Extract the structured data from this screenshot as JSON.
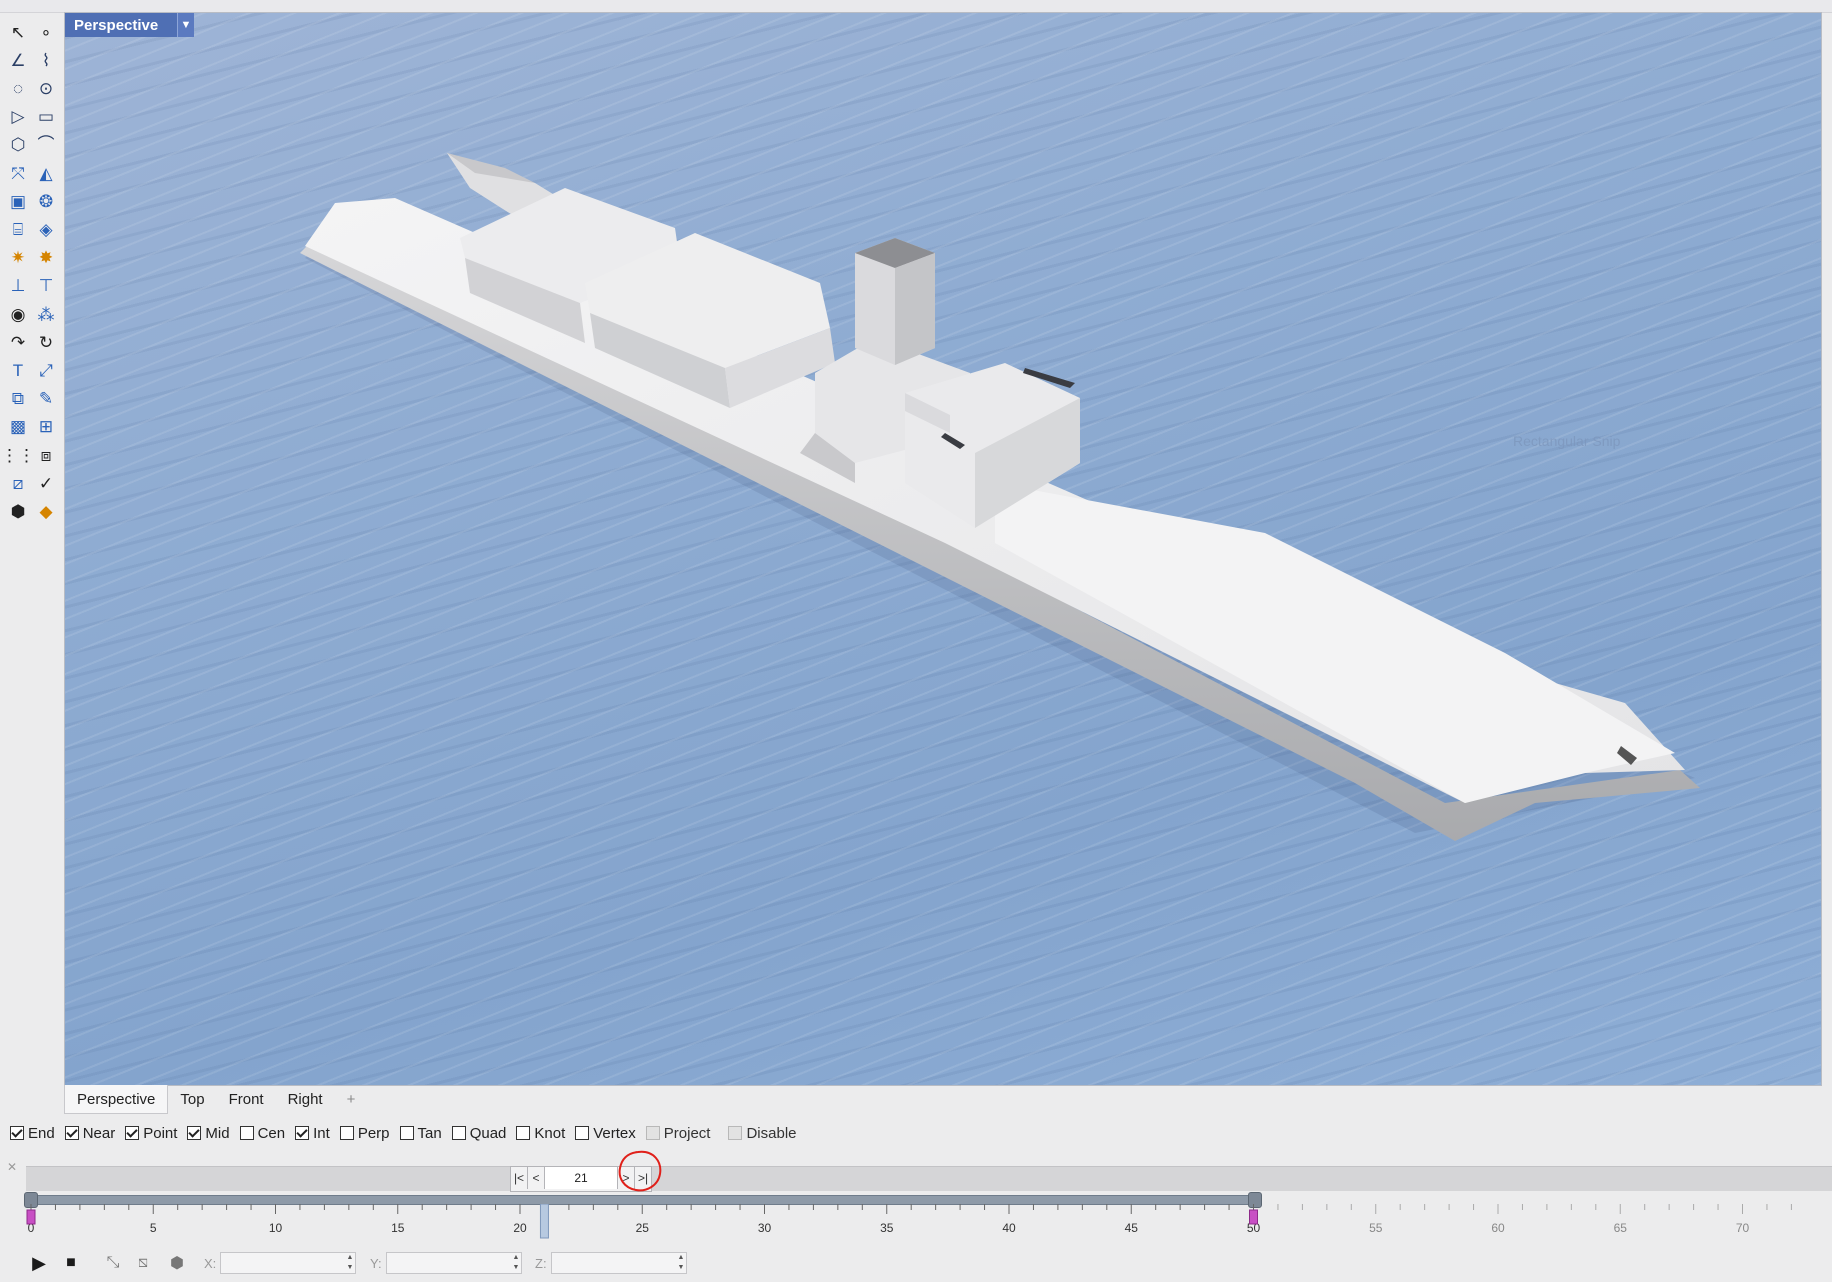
{
  "viewport": {
    "label": "Perspective",
    "dropdown_icon": "caret-down",
    "watermark": "Rectangular Snip"
  },
  "toolbar": {
    "tools": [
      {
        "name": "select-arrow-icon",
        "glyph": "↖",
        "tone": "dark"
      },
      {
        "name": "point-icon",
        "glyph": "∘",
        "tone": "dark"
      },
      {
        "name": "polyline-icon",
        "glyph": "∠",
        "tone": ""
      },
      {
        "name": "curve-points-icon",
        "glyph": "⌇",
        "tone": ""
      },
      {
        "name": "circle-icon",
        "glyph": "◌",
        "tone": ""
      },
      {
        "name": "ellipse-icon",
        "glyph": "⊙",
        "tone": ""
      },
      {
        "name": "polygon-icon",
        "glyph": "▷",
        "tone": ""
      },
      {
        "name": "rectangle-icon",
        "glyph": "▭",
        "tone": ""
      },
      {
        "name": "hexagon-icon",
        "glyph": "⬡",
        "tone": ""
      },
      {
        "name": "arc-icon",
        "glyph": "⌒",
        "tone": ""
      },
      {
        "name": "transform-icon",
        "glyph": "⤧",
        "tone": "blue"
      },
      {
        "name": "surface-icon",
        "glyph": "◭",
        "tone": "blue"
      },
      {
        "name": "box-icon",
        "glyph": "▣",
        "tone": "blue"
      },
      {
        "name": "boolean-union-icon",
        "glyph": "❂",
        "tone": "blue"
      },
      {
        "name": "cylinder-icon",
        "glyph": "⌸",
        "tone": "blue"
      },
      {
        "name": "mesh-icon",
        "glyph": "◈",
        "tone": "blue"
      },
      {
        "name": "gear-icon",
        "glyph": "✷",
        "tone": "orange"
      },
      {
        "name": "explode-icon",
        "glyph": "✸",
        "tone": "orange"
      },
      {
        "name": "extrude-icon",
        "glyph": "⊥",
        "tone": "blue"
      },
      {
        "name": "plane-icon",
        "glyph": "⊤",
        "tone": "blue"
      },
      {
        "name": "solid-icon",
        "glyph": "◉",
        "tone": "dark"
      },
      {
        "name": "spheres-icon",
        "glyph": "⁂",
        "tone": "blue"
      },
      {
        "name": "fillet-icon",
        "glyph": "↷",
        "tone": "dark"
      },
      {
        "name": "blend-icon",
        "glyph": "↻",
        "tone": "dark"
      },
      {
        "name": "text-icon",
        "glyph": "T",
        "tone": "blue"
      },
      {
        "name": "scale-icon",
        "glyph": "⤢",
        "tone": "blue"
      },
      {
        "name": "group-icon",
        "glyph": "⧉",
        "tone": "blue"
      },
      {
        "name": "edit-icon",
        "glyph": "✎",
        "tone": "blue"
      },
      {
        "name": "block-icon",
        "glyph": "▩",
        "tone": "blue"
      },
      {
        "name": "dimension-icon",
        "glyph": "⊞",
        "tone": "blue"
      },
      {
        "name": "array-icon",
        "glyph": "⋮⋮",
        "tone": "dark"
      },
      {
        "name": "layers-icon",
        "glyph": "⧈",
        "tone": "dark"
      },
      {
        "name": "analyze-icon",
        "glyph": "⧄",
        "tone": "blue"
      },
      {
        "name": "check-icon",
        "glyph": "✓",
        "tone": "dark"
      },
      {
        "name": "render-icon",
        "glyph": "⬢",
        "tone": "dark"
      },
      {
        "name": "light-icon",
        "glyph": "◆",
        "tone": "orange"
      }
    ]
  },
  "tabs": [
    {
      "label": "Perspective",
      "active": true
    },
    {
      "label": "Top",
      "active": false
    },
    {
      "label": "Front",
      "active": false
    },
    {
      "label": "Right",
      "active": false
    }
  ],
  "tab_add_glyph": "+",
  "osnaps": [
    {
      "label": "End",
      "checked": true,
      "disabled": false
    },
    {
      "label": "Near",
      "checked": true,
      "disabled": false
    },
    {
      "label": "Point",
      "checked": true,
      "disabled": false
    },
    {
      "label": "Mid",
      "checked": true,
      "disabled": false
    },
    {
      "label": "Cen",
      "checked": false,
      "disabled": false
    },
    {
      "label": "Int",
      "checked": true,
      "disabled": false
    },
    {
      "label": "Perp",
      "checked": false,
      "disabled": false
    },
    {
      "label": "Tan",
      "checked": false,
      "disabled": false
    },
    {
      "label": "Quad",
      "checked": false,
      "disabled": false
    },
    {
      "label": "Knot",
      "checked": false,
      "disabled": false
    },
    {
      "label": "Vertex",
      "checked": false,
      "disabled": false
    },
    {
      "label": "Project",
      "checked": false,
      "disabled": true
    },
    {
      "label": "Disable",
      "checked": false,
      "disabled": true
    }
  ],
  "timeline": {
    "close_glyph": "✕",
    "first_label": "|<",
    "prev_label": "<",
    "frame": "21",
    "next_label": ">",
    "last_label": ">|",
    "current_frame": 21,
    "range_start": 0,
    "range_end": 50,
    "ruler_max": 72,
    "tick_labels": [
      "0",
      "5",
      "10",
      "15",
      "20",
      "25",
      "30",
      "35",
      "40",
      "45",
      "50",
      "55",
      "60",
      "65",
      "70"
    ]
  },
  "playback": {
    "play_glyph": "▶",
    "stop_glyph": "■",
    "x_label": "X:",
    "y_label": "Y:",
    "z_label": "Z:",
    "x_value": "",
    "y_value": "",
    "z_value": ""
  }
}
